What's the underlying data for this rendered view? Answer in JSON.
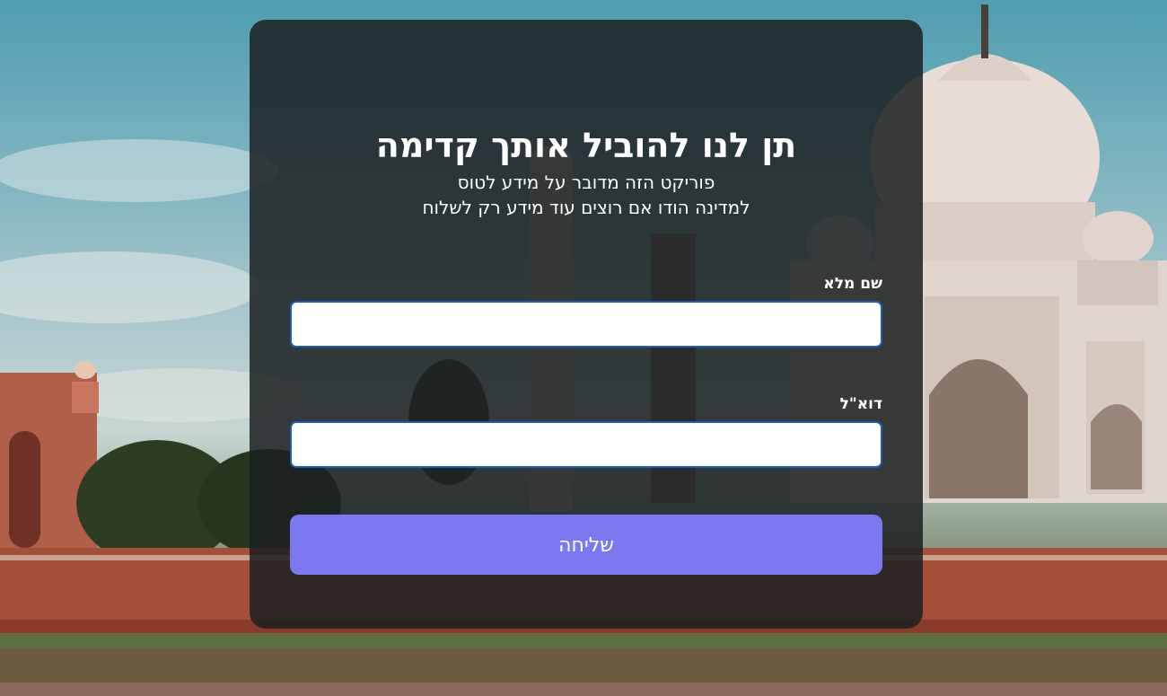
{
  "form": {
    "title": "תן לנו להוביל אותך קדימה",
    "subtitle_line1": "פוריקט הזה מדובר על מידע לטוס",
    "subtitle_line2": "למדינה הודו אם רוצים עוד מידע רק לשלוח",
    "name_label": "שם מלא",
    "name_value": "",
    "email_label": "דוא\"ל",
    "email_value": "",
    "submit_label": "שליחה"
  },
  "colors": {
    "card_bg": "#1c2122",
    "accent": "#7b78f0",
    "input_border": "#1c5fb5"
  }
}
